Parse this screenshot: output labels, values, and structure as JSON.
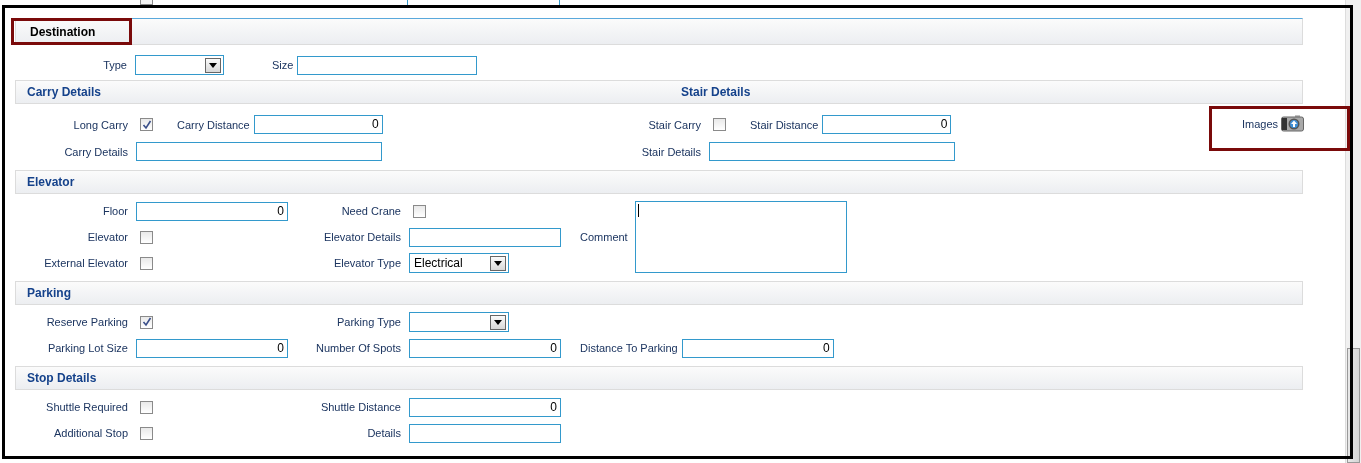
{
  "previous_section_fragment": {
    "fields": [
      {
        "kind": "checkbox",
        "checked": false
      },
      {
        "kind": "text"
      }
    ]
  },
  "destination": {
    "title": "Destination",
    "highlighted": true,
    "fields": [
      {
        "kind": "select",
        "label": "Type"
      },
      {
        "kind": "text",
        "label": "Size"
      }
    ]
  },
  "carry_details": {
    "title": "Carry Details",
    "rows": [
      [
        {
          "kind": "checkbox",
          "label": "Long Carry",
          "checked": true
        },
        {
          "kind": "number",
          "label": "Carry Distance",
          "value": "0"
        }
      ],
      [
        {
          "kind": "text",
          "label": "Carry Details"
        }
      ]
    ]
  },
  "stair_details": {
    "title": "Stair Details",
    "rows": [
      [
        {
          "kind": "checkbox",
          "label": "Stair Carry",
          "checked": false
        },
        {
          "kind": "number",
          "label": "Stair Distance",
          "value": "0"
        }
      ],
      [
        {
          "kind": "text",
          "label": "Stair Details"
        }
      ]
    ]
  },
  "images": {
    "label": "Images",
    "highlighted": true
  },
  "sections": [
    {
      "title": "Elevator",
      "rows": [
        [
          {
            "kind": "number",
            "label": "Floor",
            "value": "0"
          },
          {
            "kind": "checkbox",
            "label": "Need Crane",
            "checked": false
          }
        ],
        [
          {
            "kind": "checkbox",
            "label": "Elevator",
            "checked": false
          },
          {
            "kind": "text",
            "label": "Elevator Details"
          }
        ],
        [
          {
            "kind": "checkbox",
            "label": "External Elevator",
            "checked": false
          },
          {
            "kind": "select",
            "label": "Elevator Type",
            "value": "Electrical"
          }
        ]
      ],
      "side": {
        "kind": "textarea",
        "label": "Comment",
        "focused": true
      }
    },
    {
      "title": "Parking",
      "rows": [
        [
          {
            "kind": "checkbox",
            "label": "Reserve Parking",
            "checked": true
          },
          {
            "kind": "select",
            "label": "Parking Type"
          }
        ],
        [
          {
            "kind": "number",
            "label": "Parking Lot Size",
            "value": "0"
          },
          {
            "kind": "number",
            "label": "Number Of Spots",
            "value": "0"
          },
          {
            "kind": "number",
            "label": "Distance To Parking",
            "value": "0"
          }
        ]
      ]
    },
    {
      "title": "Stop Details",
      "rows": [
        [
          {
            "kind": "checkbox",
            "label": "Shuttle Required",
            "checked": false
          },
          {
            "kind": "number",
            "label": "Shuttle Distance",
            "value": "0"
          }
        ],
        [
          {
            "kind": "checkbox",
            "label": "Additional Stop",
            "checked": false
          },
          {
            "kind": "text",
            "label": "Details"
          }
        ]
      ]
    }
  ]
}
